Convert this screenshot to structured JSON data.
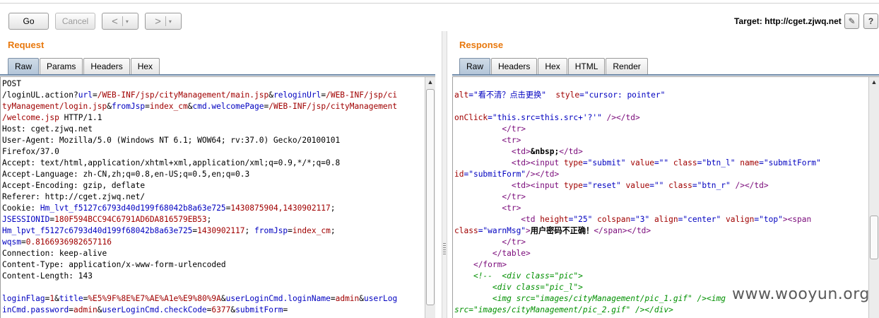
{
  "toolbar": {
    "go_label": "Go",
    "cancel_label": "Cancel",
    "back_glyph": "<",
    "forward_glyph": ">",
    "dropdown_glyph": "▾",
    "target_label": "Target: http://cget.zjwq.net",
    "edit_icon": "pencil-icon",
    "help_icon": "help-icon",
    "edit_glyph": "✎",
    "help_glyph": "?"
  },
  "request": {
    "title": "Request",
    "tabs": [
      "Raw",
      "Params",
      "Headers",
      "Hex"
    ],
    "active_tab": "Raw",
    "lines": [
      [
        [
          "POST",
          "k"
        ]
      ],
      [
        [
          "/loginUL.action?",
          "k"
        ],
        [
          "url",
          "b"
        ],
        [
          "=",
          "k"
        ],
        [
          "/WEB-INF/jsp/cityManagement/main.jsp",
          "r"
        ],
        [
          "&",
          "k"
        ],
        [
          "reloginUrl",
          "b"
        ],
        [
          "=",
          "k"
        ],
        [
          "/WEB-INF/jsp/ci",
          "r"
        ]
      ],
      [
        [
          "tyManagement/login.jsp",
          "r"
        ],
        [
          "&",
          "k"
        ],
        [
          "fromJsp",
          "b"
        ],
        [
          "=",
          "k"
        ],
        [
          "index_cm",
          "r"
        ],
        [
          "&",
          "k"
        ],
        [
          "cmd.welcomePage",
          "b"
        ],
        [
          "=",
          "k"
        ],
        [
          "/WEB-INF/jsp/cityManagement",
          "r"
        ]
      ],
      [
        [
          "/welcome.jsp",
          "r"
        ],
        [
          " HTTP/1.1",
          "k"
        ]
      ],
      [
        [
          "Host: cget.zjwq.net",
          "k"
        ]
      ],
      [
        [
          "User-Agent: Mozilla/5.0 (Windows NT 6.1; WOW64; rv:37.0) Gecko/20100101",
          "k"
        ]
      ],
      [
        [
          "Firefox/37.0",
          "k"
        ]
      ],
      [
        [
          "Accept: text/html,application/xhtml+xml,application/xml;q=0.9,*/*;q=0.8",
          "k"
        ]
      ],
      [
        [
          "Accept-Language: zh-CN,zh;q=0.8,en-US;q=0.5,en;q=0.3",
          "k"
        ]
      ],
      [
        [
          "Accept-Encoding: gzip, deflate",
          "k"
        ]
      ],
      [
        [
          "Referer: http://cget.zjwq.net/",
          "k"
        ]
      ],
      [
        [
          "Cookie: ",
          "k"
        ],
        [
          "Hm_lvt_f5127c6793d40d199f68042b8a63e725",
          "b"
        ],
        [
          "=",
          "k"
        ],
        [
          "1430875904,1430902117",
          "r"
        ],
        [
          ";",
          "k"
        ]
      ],
      [
        [
          "JSESSIONID",
          "b"
        ],
        [
          "=",
          "k"
        ],
        [
          "180F594BCC94C6791AD6DA816579EB53",
          "r"
        ],
        [
          ";",
          "k"
        ]
      ],
      [
        [
          "Hm_lpvt_f5127c6793d40d199f68042b8a63e725",
          "b"
        ],
        [
          "=",
          "k"
        ],
        [
          "1430902117",
          "r"
        ],
        [
          "; ",
          "k"
        ],
        [
          "fromJsp",
          "b"
        ],
        [
          "=",
          "k"
        ],
        [
          "index_cm",
          "r"
        ],
        [
          ";",
          "k"
        ]
      ],
      [
        [
          "wqsm",
          "b"
        ],
        [
          "=",
          "k"
        ],
        [
          "0.8166936982657116",
          "r"
        ]
      ],
      [
        [
          "Connection: keep-alive",
          "k"
        ]
      ],
      [
        [
          "Content-Type: application/x-www-form-urlencoded",
          "k"
        ]
      ],
      [
        [
          "Content-Length: 143",
          "k"
        ]
      ],
      [
        [
          "",
          "k"
        ]
      ],
      [
        [
          "loginFlag",
          "b"
        ],
        [
          "=",
          "k"
        ],
        [
          "1",
          "r"
        ],
        [
          "&",
          "k"
        ],
        [
          "title",
          "b"
        ],
        [
          "=",
          "k"
        ],
        [
          "%E5%9F%8E%E7%AE%A1e%E9%80%9A",
          "r"
        ],
        [
          "&",
          "k"
        ],
        [
          "userLoginCmd.loginName",
          "b"
        ],
        [
          "=",
          "k"
        ],
        [
          "admin",
          "r"
        ],
        [
          "&",
          "k"
        ],
        [
          "userLog",
          "b"
        ]
      ],
      [
        [
          "inCmd.password",
          "b"
        ],
        [
          "=",
          "k"
        ],
        [
          "admin",
          "r"
        ],
        [
          "&",
          "k"
        ],
        [
          "userLoginCmd.checkCode",
          "b"
        ],
        [
          "=",
          "k"
        ],
        [
          "6377",
          "r"
        ],
        [
          "&",
          "k"
        ],
        [
          "submitForm",
          "b"
        ],
        [
          "=",
          "k"
        ]
      ]
    ]
  },
  "response": {
    "title": "Response",
    "tabs": [
      "Raw",
      "Headers",
      "Hex",
      "HTML",
      "Render"
    ],
    "active_tab": "Raw",
    "lines": [
      [
        [
          "",
          "k"
        ]
      ],
      [
        [
          "alt",
          "r"
        ],
        [
          "=\"看不清？点击更换\"  ",
          "b"
        ],
        [
          "style",
          "r"
        ],
        [
          "=\"cursor: pointer\"",
          "b"
        ]
      ],
      [
        [
          "",
          "k"
        ]
      ],
      [
        [
          "onClick",
          "r"
        ],
        [
          "=\"this.src=this.src+'?'\" ",
          "b"
        ],
        [
          "/></td>",
          "p"
        ]
      ],
      [
        [
          "          ",
          "k"
        ],
        [
          "</tr>",
          "p"
        ]
      ],
      [
        [
          "          ",
          "k"
        ],
        [
          "<tr>",
          "p"
        ]
      ],
      [
        [
          "            ",
          "k"
        ],
        [
          "<td>",
          "p"
        ],
        [
          "&nbsp;",
          "x"
        ],
        [
          "</td>",
          "p"
        ]
      ],
      [
        [
          "            ",
          "k"
        ],
        [
          "<td>",
          "p"
        ],
        [
          "<input ",
          "p"
        ],
        [
          "type",
          "r"
        ],
        [
          "=\"submit\" ",
          "b"
        ],
        [
          "value",
          "r"
        ],
        [
          "=\"\" ",
          "b"
        ],
        [
          "class",
          "r"
        ],
        [
          "=\"btn_l\" ",
          "b"
        ],
        [
          "name",
          "r"
        ],
        [
          "=\"submitForm\"",
          "b"
        ]
      ],
      [
        [
          "id",
          "r"
        ],
        [
          "=\"submitForm\"",
          "b"
        ],
        [
          "/></td>",
          "p"
        ]
      ],
      [
        [
          "            ",
          "k"
        ],
        [
          "<td>",
          "p"
        ],
        [
          "<input ",
          "p"
        ],
        [
          "type",
          "r"
        ],
        [
          "=\"reset\" ",
          "b"
        ],
        [
          "value",
          "r"
        ],
        [
          "=\"\" ",
          "b"
        ],
        [
          "class",
          "r"
        ],
        [
          "=\"btn_r\" ",
          "b"
        ],
        [
          "/></td>",
          "p"
        ]
      ],
      [
        [
          "          ",
          "k"
        ],
        [
          "</tr>",
          "p"
        ]
      ],
      [
        [
          "          ",
          "k"
        ],
        [
          "<tr>",
          "p"
        ]
      ],
      [
        [
          "              ",
          "k"
        ],
        [
          "<td ",
          "p"
        ],
        [
          "height",
          "r"
        ],
        [
          "=\"25\" ",
          "b"
        ],
        [
          "colspan",
          "r"
        ],
        [
          "=\"3\" ",
          "b"
        ],
        [
          "align",
          "r"
        ],
        [
          "=\"center\" ",
          "b"
        ],
        [
          "valign",
          "r"
        ],
        [
          "=\"top\"",
          "b"
        ],
        [
          ">",
          "p"
        ],
        [
          "<span",
          "p"
        ]
      ],
      [
        [
          "class",
          "r"
        ],
        [
          "=\"warnMsg\"",
          "b"
        ],
        [
          ">",
          "p"
        ],
        [
          "用户密码不正确！",
          "x"
        ],
        [
          "</span>",
          "p"
        ],
        [
          "</td>",
          "p"
        ]
      ],
      [
        [
          "          ",
          "k"
        ],
        [
          "</tr>",
          "p"
        ]
      ],
      [
        [
          "        ",
          "k"
        ],
        [
          "</table>",
          "p"
        ]
      ],
      [
        [
          "    ",
          "k"
        ],
        [
          "</form>",
          "p"
        ]
      ],
      [
        [
          "    ",
          "k"
        ],
        [
          "<!--  <div class=\"pic\">",
          "g"
        ]
      ],
      [
        [
          "        ",
          "k"
        ],
        [
          "<div class=\"pic_l\">",
          "g"
        ]
      ],
      [
        [
          "        ",
          "k"
        ],
        [
          "<img src=\"images/cityManagement/pic_1.gif\" /><img",
          "g"
        ]
      ],
      [
        [
          "src=\"images/cityManagement/pic_2.gif\" /></div>",
          "g"
        ]
      ]
    ]
  },
  "watermark": "www.wooyun.org"
}
